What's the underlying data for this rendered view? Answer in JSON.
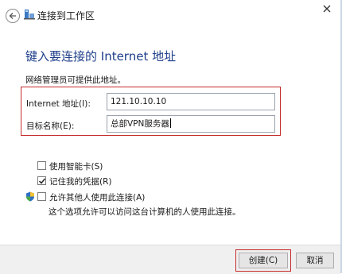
{
  "window": {
    "title": "连接到工作区",
    "back_icon": "back-arrow-icon",
    "app_icon": "network-icon",
    "close_icon": "close-icon"
  },
  "main": {
    "heading": "键入要连接的 Internet 地址",
    "info": "网络管理员可提供此地址。",
    "fields": {
      "address": {
        "label": "Internet 地址(I):",
        "value": "121.10.10.10"
      },
      "name": {
        "label": "目标名称(E):",
        "value": "总部VPN服务器"
      }
    },
    "options": {
      "smart_card": {
        "label": "使用智能卡(S)",
        "checked": false
      },
      "remember": {
        "label": "记住我的凭据(R)",
        "checked": true
      },
      "allow_others": {
        "label": "允许其他人使用此连接(A)",
        "checked": false,
        "icon": "shield-icon",
        "note": "这个选项允许可以访问这台计算机的人使用此连接。"
      }
    }
  },
  "footer": {
    "create_label": "创建(C)",
    "cancel_label": "取消"
  },
  "colors": {
    "heading": "#1e3f8a",
    "highlight": "#c42b2b",
    "footer_bg": "#f0f0f0"
  }
}
